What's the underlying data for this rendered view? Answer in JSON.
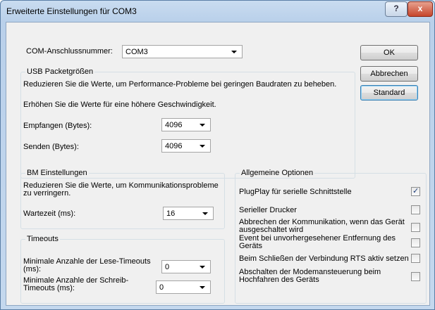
{
  "window": {
    "title": "Erweiterte Einstellungen für COM3",
    "help_glyph": "?",
    "close_glyph": "x"
  },
  "com": {
    "label": "COM-Anschlussnummer:",
    "value": "COM3"
  },
  "buttons": {
    "ok": "OK",
    "cancel": "Abbrechen",
    "default": "Standard"
  },
  "usb": {
    "title": "USB Packetgrößen",
    "desc1": "Reduzieren Sie die Werte, um Performance-Probleme bei geringen Baudraten zu beheben.",
    "desc2": "Erhöhen Sie die Werte für eine höhere Geschwindigkeit.",
    "receive_label": "Empfangen (Bytes):",
    "receive_value": "4096",
    "send_label": "Senden (Bytes):",
    "send_value": "4096"
  },
  "bm": {
    "title": "BM Einstellungen",
    "desc": "Reduzieren Sie die Werte, um Kommunikationsprobleme zu verringern.",
    "latency_label": "Wartezeit (ms):",
    "latency_value": "16"
  },
  "timeouts": {
    "title": "Timeouts",
    "read_label": "Minimale Anzahle der Lese-Timeouts (ms):",
    "read_value": "0",
    "write_label": "Minimale Anzahle der Schreib-Timeouts (ms):",
    "write_value": "0"
  },
  "options": {
    "title": "Allgemeine Optionen",
    "items": [
      {
        "label": "PlugPlay für serielle Schnittstelle",
        "checked": true
      },
      {
        "label": "Serieller Drucker",
        "checked": false
      },
      {
        "label": "Abbrechen der Kommunikation, wenn das Gerät ausgeschaltet wird",
        "checked": false
      },
      {
        "label": "Event bei unvorhergesehener Entfernung des Geräts",
        "checked": false
      },
      {
        "label": "Beim Schließen der Verbindung RTS aktiv setzen",
        "checked": false
      },
      {
        "label": "Abschalten der Modemansteuerung beim Hochfahren des Geräts",
        "checked": false
      }
    ],
    "check_glyph": "✓"
  }
}
